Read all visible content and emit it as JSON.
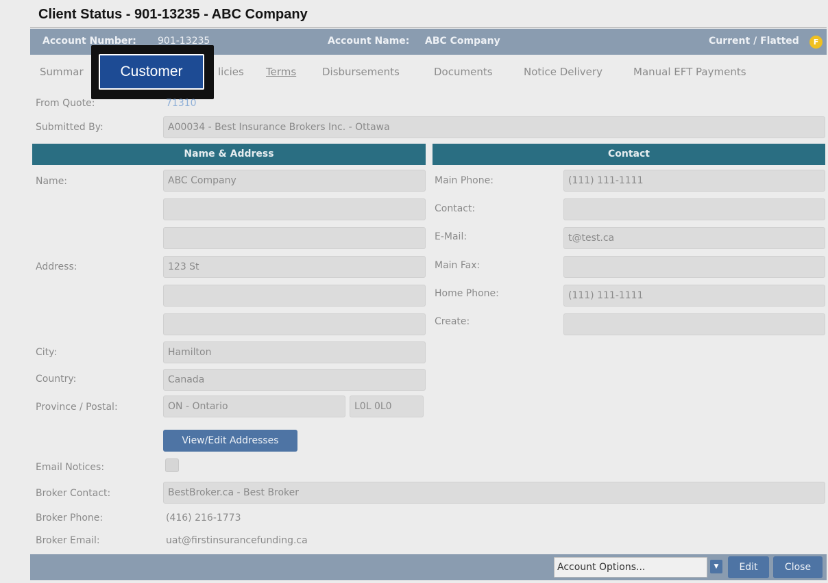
{
  "window": {
    "title": "Client Status - 901-13235 - ABC Company"
  },
  "header": {
    "account_number_label": "Account Number:",
    "account_number": "901-13235",
    "account_name_label": "Account Name:",
    "account_name": "ABC Company",
    "status": "Current / Flatted",
    "status_badge": "F"
  },
  "tabs": [
    {
      "label": "Summar"
    },
    {
      "label": "Customer",
      "active": true
    },
    {
      "label": "licies"
    },
    {
      "label": "Terms"
    },
    {
      "label": "Disbursements"
    },
    {
      "label": "Documents"
    },
    {
      "label": "Notice Delivery"
    },
    {
      "label": "Manual EFT Payments"
    }
  ],
  "info": {
    "from_quote_label": "From Quote:",
    "from_quote_value": "71310",
    "submitted_by_label": "Submitted By:",
    "submitted_by_value": "A00034 - Best Insurance Brokers Inc. - Ottawa"
  },
  "name_address": {
    "heading": "Name & Address",
    "name_label": "Name:",
    "name_lines": [
      "ABC Company",
      "",
      ""
    ],
    "address_label": "Address:",
    "address_lines": [
      "123 St",
      "",
      ""
    ],
    "city_label": "City:",
    "city": "Hamilton",
    "country_label": "Country:",
    "country": "Canada",
    "province_postal_label": "Province / Postal:",
    "province": "ON - Ontario",
    "postal": "L0L 0L0",
    "view_edit_button": "View/Edit Addresses"
  },
  "contact": {
    "heading": "Contact",
    "main_phone_label": "Main Phone:",
    "main_phone": "(111) 111-1111",
    "contact_label": "Contact:",
    "contact": "",
    "email_label": "E-Mail:",
    "email": "t@test.ca",
    "main_fax_label": "Main Fax:",
    "main_fax": "",
    "home_phone_label": "Home Phone:",
    "home_phone": "(111) 111-1111",
    "create_label": "Create:",
    "create": ""
  },
  "broker": {
    "email_notices_label": "Email Notices:",
    "email_notices_checked": false,
    "broker_contact_label": "Broker Contact:",
    "broker_contact": "BestBroker.ca - Best Broker",
    "broker_phone_label": "Broker Phone:",
    "broker_phone": "(416) 216-1773",
    "broker_email_label": "Broker Email:",
    "broker_email": "uat@firstinsurancefunding.ca"
  },
  "footer": {
    "account_options": "Account Options...",
    "edit_label": "Edit",
    "close_label": "Close"
  },
  "colors": {
    "header_bar": "#8a9cb0",
    "section_heading": "#2a6e82",
    "active_tab": "#1d4b94",
    "button": "#4e74a4",
    "badge": "#f0c020"
  }
}
